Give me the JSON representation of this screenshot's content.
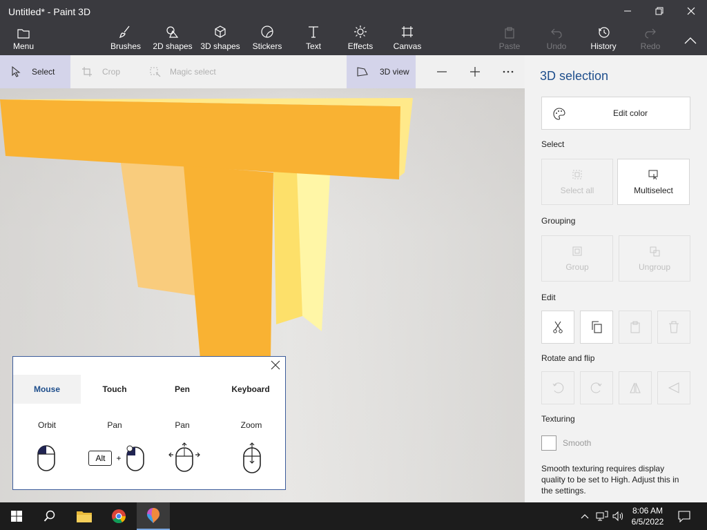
{
  "window": {
    "title": "Untitled* - Paint 3D"
  },
  "ribbon": {
    "menu": "Menu",
    "tools": [
      "Brushes",
      "2D shapes",
      "3D shapes",
      "Stickers",
      "Text",
      "Effects",
      "Canvas"
    ],
    "paste": "Paste",
    "undo": "Undo",
    "history": "History",
    "redo": "Redo"
  },
  "toolrow": {
    "select": "Select",
    "crop": "Crop",
    "magic_select": "Magic select",
    "view3d": "3D view"
  },
  "panel": {
    "title": "3D selection",
    "edit_color": "Edit color",
    "select_label": "Select",
    "select_all": "Select all",
    "multiselect": "Multiselect",
    "grouping_label": "Grouping",
    "group": "Group",
    "ungroup": "Ungroup",
    "edit_label": "Edit",
    "rotate_label": "Rotate and flip",
    "texturing_label": "Texturing",
    "smooth": "Smooth",
    "smooth_note": "Smooth texturing requires display quality to be set to High. Adjust this in the settings."
  },
  "help": {
    "tabs": [
      "Mouse",
      "Touch",
      "Pen",
      "Keyboard"
    ],
    "active_tab": "Mouse",
    "actions": [
      "Orbit",
      "Pan",
      "Pan",
      "Zoom"
    ],
    "alt_key": "Alt",
    "plus": "+"
  },
  "taskbar": {
    "time": "8:06 AM",
    "date": "6/5/2022"
  },
  "colors": {
    "accent": "#1e4e8c",
    "titlebar": "#3a3a3f",
    "object_main": "#f9b233",
    "object_light": "#ffe98a"
  }
}
